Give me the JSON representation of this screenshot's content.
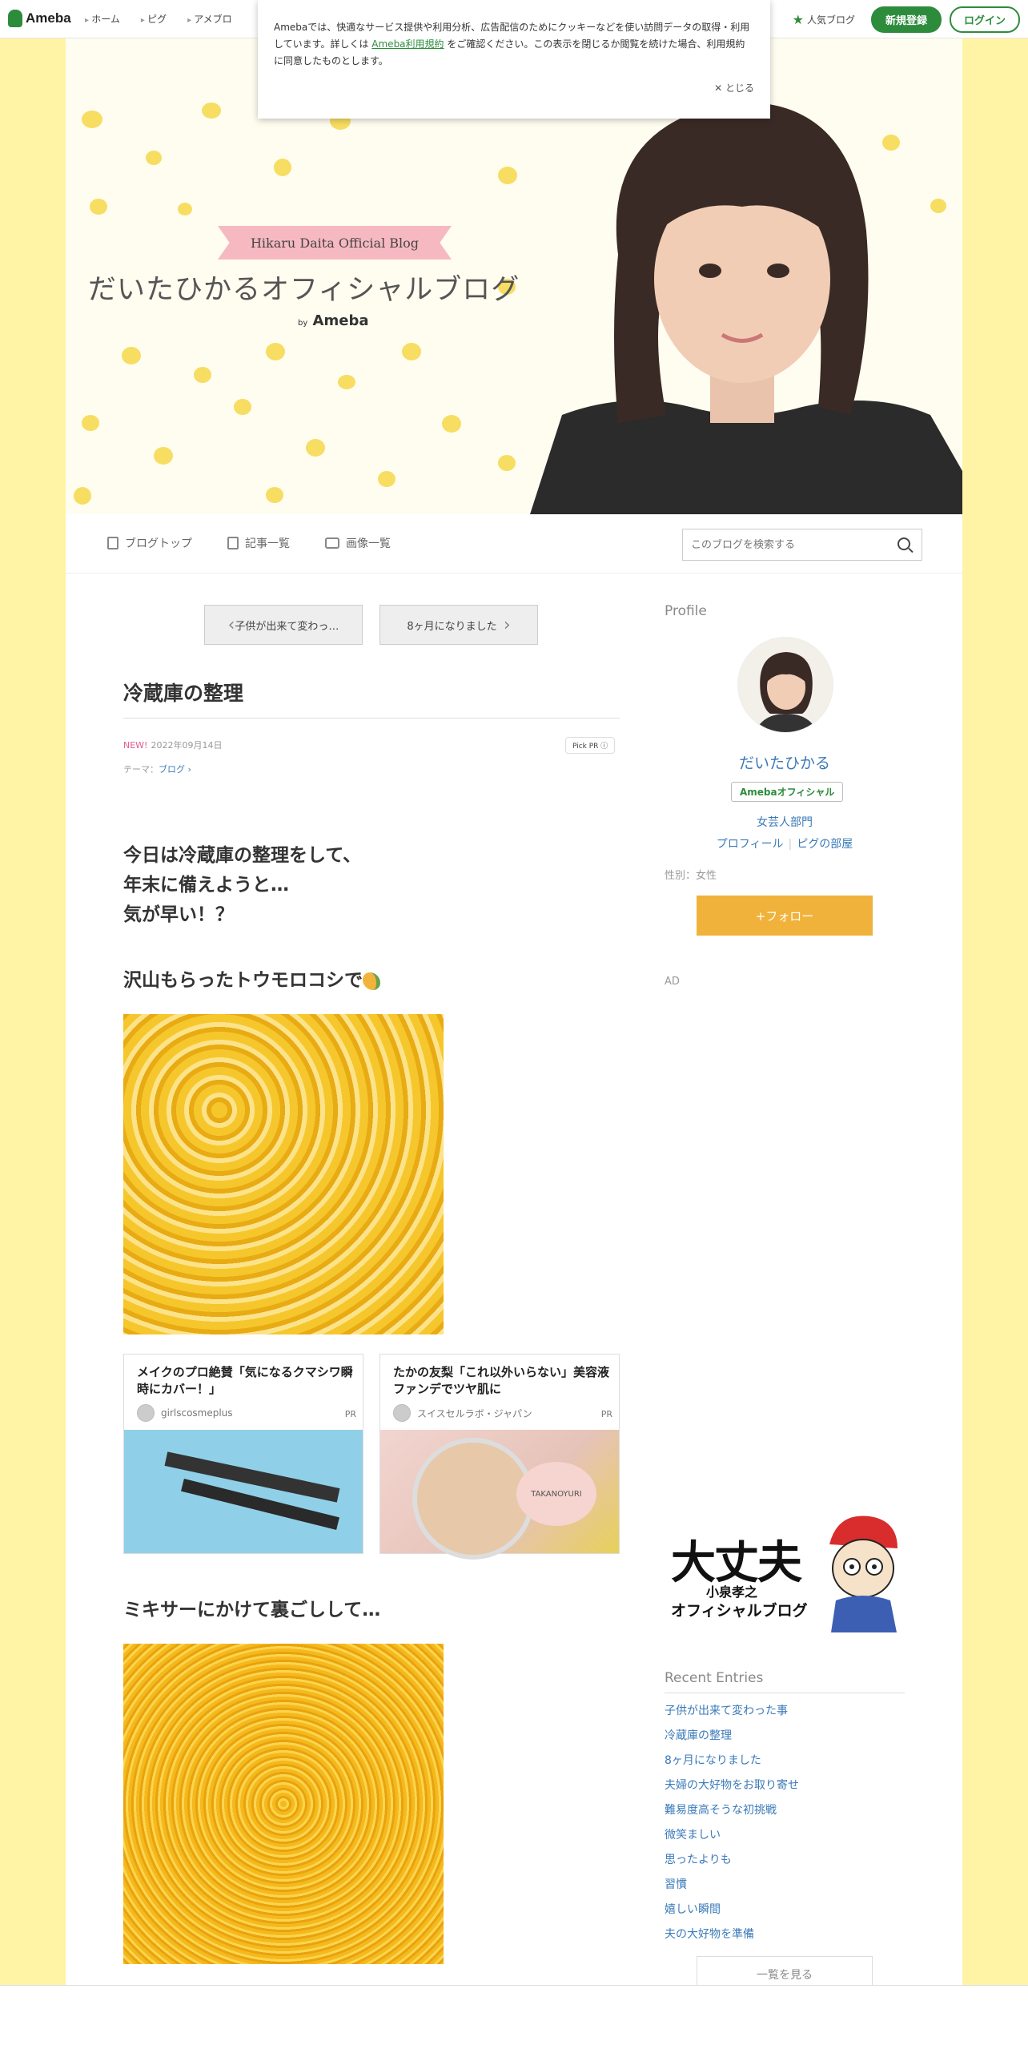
{
  "topbar": {
    "logo": "Ameba",
    "nav": [
      "ホーム",
      "ピグ",
      "アメブロ"
    ],
    "ranking": "人気ブログ",
    "signup": "新規登録",
    "login": "ログイン"
  },
  "cookie": {
    "text_before": "Amebaでは、快適なサービス提供や利用分析、広告配信のためにクッキーなどを使い訪問データの取得・利用しています。詳しくは",
    "link": "Ameba利用規約",
    "text_after": "をご確認ください。この表示を閉じるか閲覧を続けた場合、利用規約に同意したものとします。",
    "close": "✕ とじる"
  },
  "header": {
    "banner": "Hikaru Daita Official Blog",
    "title": "だいたひかるオフィシャルブログ",
    "by": "by",
    "ameba": "Ameba"
  },
  "subnav": {
    "items": [
      "ブログトップ",
      "記事一覧",
      "画像一覧"
    ],
    "search_placeholder": "このブログを検索する"
  },
  "article": {
    "prev": "子供が出来て変わっ…",
    "next": "8ヶ月になりました",
    "title": "冷蔵庫の整理",
    "new": "NEW!",
    "date": "2022年09月14日",
    "pick": "Pick PR ⓘ",
    "theme_label": "テーマ：",
    "theme": "ブログ",
    "para": [
      "今日は冷蔵庫の整理をして、",
      "年末に備えようと…",
      "気が早い！？"
    ],
    "sub1": "沢山もらったトウモロコシで",
    "sub2": "ミキサーにかけて裏ごしして…"
  },
  "ads": [
    {
      "headline": "メイクのプロ絶賛「気になるクマシワ瞬時にカバー！」",
      "source": "girlscosmeplus",
      "pr": "PR"
    },
    {
      "headline": "たかの友梨「これ以外いらない」美容液ファンデでツヤ肌に",
      "source": "スイスセルラボ・ジャパン",
      "pr": "PR"
    }
  ],
  "sidebar": {
    "profile_heading": "Profile",
    "name": "だいたひかる",
    "official": "Amebaオフィシャル",
    "genre": "女芸人部門",
    "profile_link": "プロフィール",
    "room_link": "ピグの部屋",
    "gender": "性別：女性",
    "follow": "+フォロー",
    "ad": "AD",
    "promo": {
      "big": "大丈夫",
      "name": "小泉孝之",
      "sub": "オフィシャルブログ"
    },
    "recent_heading": "Recent Entries",
    "recent": [
      "子供が出来て変わった事",
      "冷蔵庫の整理",
      "8ヶ月になりました",
      "夫婦の大好物をお取り寄せ",
      "難易度高そうな初挑戦",
      "微笑ましい",
      "思ったよりも",
      "習慣",
      "嬉しい瞬間",
      "夫の大好物を準備"
    ],
    "more": "一覧を見る"
  },
  "colors": {
    "brand_green": "#2d8c3c",
    "follow_orange": "#f0b23a",
    "link_blue": "#3a7ab8",
    "background_yellow": "#fff3a6"
  }
}
